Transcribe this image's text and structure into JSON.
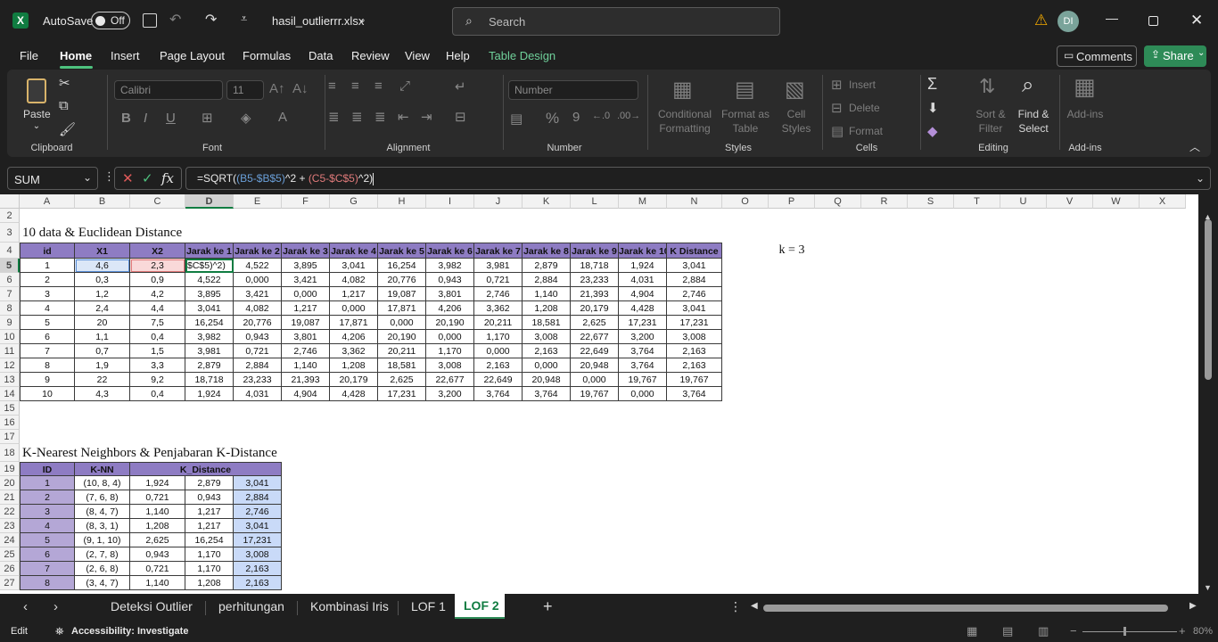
{
  "titlebar": {
    "autosave": "AutoSave",
    "toggle": "Off",
    "filename": "hasil_outlierrr.xlsx",
    "search_placeholder": "Search",
    "avatar": "DI"
  },
  "menu": {
    "items": [
      "File",
      "Home",
      "Insert",
      "Page Layout",
      "Formulas",
      "Data",
      "Review",
      "View",
      "Help",
      "Table Design"
    ],
    "comments": "Comments",
    "share": "Share"
  },
  "ribbon": {
    "clipboard": {
      "paste": "Paste",
      "label": "Clipboard"
    },
    "font": {
      "name": "Calibri",
      "size": "11",
      "label": "Font",
      "bold": "B",
      "italic": "I",
      "underline": "U"
    },
    "alignment": {
      "label": "Alignment"
    },
    "number": {
      "format": "Number",
      "label": "Number",
      "percent": "%",
      "comma": "9"
    },
    "styles": {
      "conditional": "Conditional",
      "formatting": "Formatting",
      "format_as": "Format as",
      "table": "Table",
      "cell": "Cell",
      "styles_btn": "Styles",
      "label": "Styles"
    },
    "cells": {
      "insert": "Insert",
      "delete": "Delete",
      "format": "Format",
      "label": "Cells"
    },
    "editing": {
      "sort": "Sort &",
      "filter": "Filter",
      "find": "Find &",
      "select": "Select",
      "label": "Editing"
    },
    "addins": {
      "btn": "Add-ins",
      "label": "Add-ins"
    }
  },
  "formula_bar": {
    "name_box": "SUM",
    "fx": "fx",
    "formula_prefix": "=SQRT(",
    "part1": "(B5-$B$5)",
    "mid": "^2 + ",
    "part2": "(C5-$C$5)",
    "suffix": "^2)"
  },
  "columns": [
    "A",
    "B",
    "C",
    "D",
    "E",
    "F",
    "G",
    "H",
    "I",
    "J",
    "K",
    "L",
    "M",
    "N",
    "O",
    "P",
    "Q",
    "R",
    "S",
    "T",
    "U",
    "V",
    "W",
    "X"
  ],
  "rows": [
    "2",
    "3",
    "4",
    "5",
    "6",
    "7",
    "8",
    "9",
    "10",
    "11",
    "12",
    "13",
    "14",
    "15",
    "16",
    "17",
    "18",
    "19",
    "20",
    "21",
    "22",
    "23",
    "24",
    "25",
    "26",
    "27"
  ],
  "section1": {
    "title": "10 data & Euclidean Distance",
    "k_label": "k = 3",
    "headers": [
      "id",
      "X1",
      "X2",
      "Jarak ke 1",
      "Jarak ke 2",
      "Jarak ke 3",
      "Jarak ke 4",
      "Jarak ke 5",
      "Jarak ke 6",
      "Jarak ke 7",
      "Jarak ke 8",
      "Jarak ke 9",
      "Jarak ke 10",
      "K Distance"
    ],
    "rows": [
      [
        "1",
        "4,6",
        "2,3",
        "$C$5)^2)",
        "4,522",
        "3,895",
        "3,041",
        "16,254",
        "3,982",
        "3,981",
        "2,879",
        "18,718",
        "1,924",
        "3,041"
      ],
      [
        "2",
        "0,3",
        "0,9",
        "4,522",
        "0,000",
        "3,421",
        "4,082",
        "20,776",
        "0,943",
        "0,721",
        "2,884",
        "23,233",
        "4,031",
        "2,884"
      ],
      [
        "3",
        "1,2",
        "4,2",
        "3,895",
        "3,421",
        "0,000",
        "1,217",
        "19,087",
        "3,801",
        "2,746",
        "1,140",
        "21,393",
        "4,904",
        "2,746"
      ],
      [
        "4",
        "2,4",
        "4,4",
        "3,041",
        "4,082",
        "1,217",
        "0,000",
        "17,871",
        "4,206",
        "3,362",
        "1,208",
        "20,179",
        "4,428",
        "3,041"
      ],
      [
        "5",
        "20",
        "7,5",
        "16,254",
        "20,776",
        "19,087",
        "17,871",
        "0,000",
        "20,190",
        "20,211",
        "18,581",
        "2,625",
        "17,231",
        "17,231"
      ],
      [
        "6",
        "1,1",
        "0,4",
        "3,982",
        "0,943",
        "3,801",
        "4,206",
        "20,190",
        "0,000",
        "1,170",
        "3,008",
        "22,677",
        "3,200",
        "3,008"
      ],
      [
        "7",
        "0,7",
        "1,5",
        "3,981",
        "0,721",
        "2,746",
        "3,362",
        "20,211",
        "1,170",
        "0,000",
        "2,163",
        "22,649",
        "3,764",
        "2,163"
      ],
      [
        "8",
        "1,9",
        "3,3",
        "2,879",
        "2,884",
        "1,140",
        "1,208",
        "18,581",
        "3,008",
        "2,163",
        "0,000",
        "20,948",
        "3,764",
        "2,163"
      ],
      [
        "9",
        "22",
        "9,2",
        "18,718",
        "23,233",
        "21,393",
        "20,179",
        "2,625",
        "22,677",
        "22,649",
        "20,948",
        "0,000",
        "19,767",
        "19,767"
      ],
      [
        "10",
        "4,3",
        "0,4",
        "1,924",
        "4,031",
        "4,904",
        "4,428",
        "17,231",
        "3,200",
        "3,764",
        "3,764",
        "19,767",
        "0,000",
        "3,764"
      ]
    ]
  },
  "section2": {
    "title": "K-Nearest Neighbors & Penjabaran K-Distance",
    "headers": [
      "ID",
      "K-NN",
      "K_Distance"
    ],
    "rows": [
      [
        "1",
        "(10, 8, 4)",
        "1,924",
        "2,879",
        "3,041"
      ],
      [
        "2",
        "(7, 6, 8)",
        "0,721",
        "0,943",
        "2,884"
      ],
      [
        "3",
        "(8, 4, 7)",
        "1,140",
        "1,217",
        "2,746"
      ],
      [
        "4",
        "(8, 3, 1)",
        "1,208",
        "1,217",
        "3,041"
      ],
      [
        "5",
        "(9, 1, 10)",
        "2,625",
        "16,254",
        "17,231"
      ],
      [
        "6",
        "(2, 7, 8)",
        "0,943",
        "1,170",
        "3,008"
      ],
      [
        "7",
        "(2, 6, 8)",
        "0,721",
        "1,170",
        "2,163"
      ],
      [
        "8",
        "(3, 4, 7)",
        "1,140",
        "1,208",
        "2,163"
      ]
    ]
  },
  "sheets": [
    "Deteksi Outlier",
    "perhitungan",
    "Kombinasi Iris",
    "LOF 1",
    "LOF 2"
  ],
  "active_sheet": "LOF 2",
  "status": {
    "mode": "Edit",
    "accessibility": "Accessibility: Investigate",
    "zoom": "80%"
  }
}
